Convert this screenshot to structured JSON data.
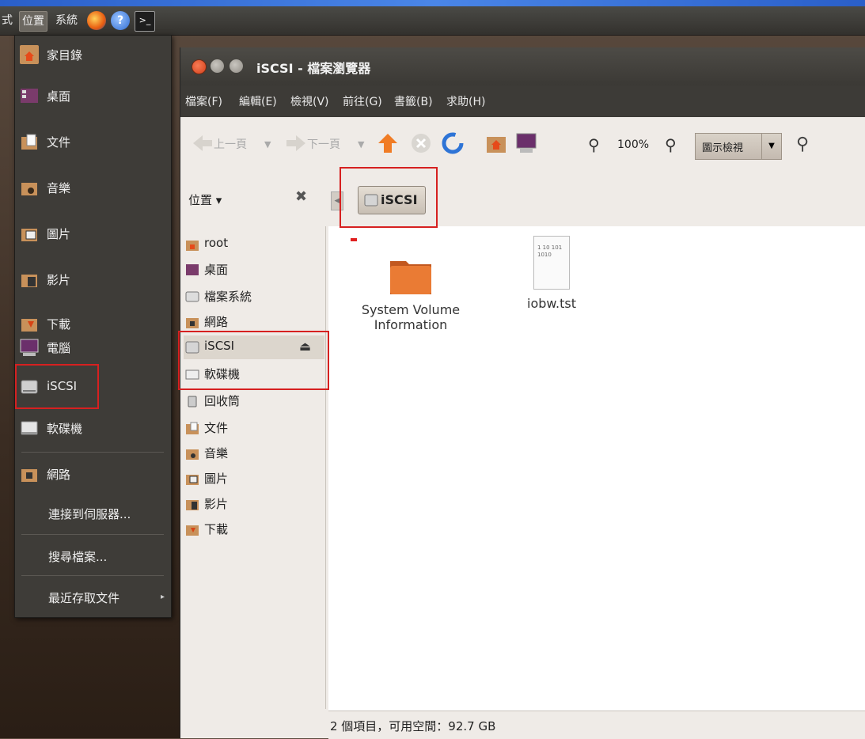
{
  "panel": {
    "cut_label": "式",
    "places_label": "位置",
    "system_label": "系統"
  },
  "menu": {
    "items": [
      {
        "label": "家目錄",
        "icon": "home-folder-icon"
      },
      {
        "label": "桌面",
        "icon": "desktop-icon"
      },
      {
        "label": "文件",
        "icon": "documents-folder-icon"
      },
      {
        "label": "音樂",
        "icon": "music-folder-icon"
      },
      {
        "label": "圖片",
        "icon": "pictures-folder-icon"
      },
      {
        "label": "影片",
        "icon": "videos-folder-icon"
      },
      {
        "label": "下載",
        "icon": "downloads-folder-icon"
      },
      {
        "label": "電腦",
        "icon": "computer-icon"
      },
      {
        "label": "iSCSI",
        "icon": "drive-icon"
      },
      {
        "label": "軟碟機",
        "icon": "floppy-icon"
      },
      {
        "label": "網路",
        "icon": "network-icon"
      }
    ],
    "connect_label": "連接到伺服器...",
    "search_label": "搜尋檔案...",
    "recent_label": "最近存取文件"
  },
  "window": {
    "title": "iSCSI - 檔案瀏覽器",
    "menubar": [
      "檔案(F)",
      "編輯(E)",
      "檢視(V)",
      "前往(G)",
      "書籤(B)",
      "求助(H)"
    ],
    "toolbar": {
      "back_label": "上一頁",
      "forward_label": "下一頁",
      "zoom": "100%",
      "view_label": "圖示檢視"
    },
    "location": {
      "sidebar_title": "位置",
      "crumb": "iSCSI"
    },
    "sidebar": [
      {
        "label": "root",
        "icon": "home-folder-icon"
      },
      {
        "label": "桌面",
        "icon": "desktop-icon"
      },
      {
        "label": "檔案系統",
        "icon": "filesystem-icon"
      },
      {
        "label": "網路",
        "icon": "network-icon"
      },
      {
        "label": "iSCSI",
        "icon": "drive-icon"
      },
      {
        "label": "軟碟機",
        "icon": "floppy-icon"
      },
      {
        "label": "回收筒",
        "icon": "trash-icon"
      },
      {
        "label": "文件",
        "icon": "documents-folder-icon"
      },
      {
        "label": "音樂",
        "icon": "music-folder-icon"
      },
      {
        "label": "圖片",
        "icon": "pictures-folder-icon"
      },
      {
        "label": "影片",
        "icon": "videos-folder-icon"
      },
      {
        "label": "下載",
        "icon": "downloads-folder-icon"
      }
    ],
    "files": [
      {
        "line1": "System Volume",
        "line2": "Information",
        "icon": "folder-icon"
      },
      {
        "line1": "iobw.tst",
        "line2": "",
        "icon": "text-file-icon",
        "preview": "1 10 101 1010"
      }
    ],
    "status": "2 個項目，可用空間：92.7 GB"
  },
  "colors": {
    "highlight": "#d62020",
    "folder": "#e9792f",
    "accent": "#dd4814"
  }
}
